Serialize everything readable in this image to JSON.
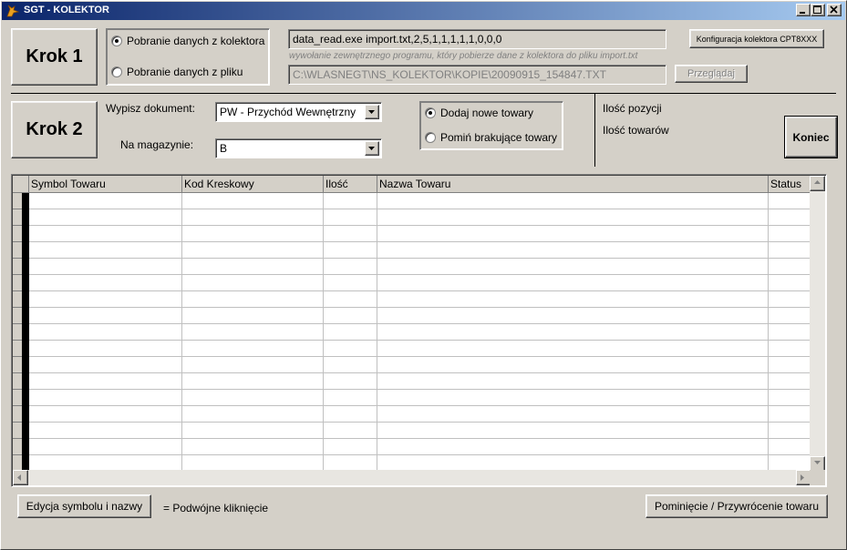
{
  "window": {
    "title": "SGT - KOLEKTOR",
    "icon": "fox-app-icon"
  },
  "step1": {
    "button_label": "Krok 1",
    "radio_collector": "Pobranie danych z kolektora",
    "radio_file": "Pobranie danych z pliku",
    "selected": "collector",
    "command_value": "data_read.exe import.txt,2,5,1,1,1,1,1,0,0,0",
    "command_hint": "wywołanie zewnętrznego programu, który pobierze dane z kolektora do pliku import.txt",
    "file_path": "C:\\WLASNEGT\\NS_KOLEKTOR\\KOPIE\\20090915_154847.TXT",
    "browse_label": "Przeglądaj",
    "config_label": "Konfiguracja kolektora CPT8XXX"
  },
  "step2": {
    "button_label": "Krok 2",
    "document_label": "Wypisz dokument:",
    "document_value": "PW - Przychód Wewnętrzny",
    "warehouse_label": "Na magazynie:",
    "warehouse_value": "B",
    "radio_add": "Dodaj nowe towary",
    "radio_skip": "Pomiń brakujące towary",
    "selected": "add"
  },
  "summary": {
    "positions_label": "Ilość pozycji",
    "items_label": "Ilość towarów",
    "end_label": "Koniec"
  },
  "grid": {
    "columns": [
      "Symbol Towaru",
      "Kod Kreskowy",
      "Ilość",
      "Nazwa Towaru",
      "Status"
    ],
    "rows": []
  },
  "footer": {
    "edit_label": "Edycja symbolu i nazwy",
    "edit_hint": "= Podwójne kliknięcie",
    "skip_restore_label": "Pominięcie / Przywrócenie towaru"
  },
  "colors": {
    "face": "#d4d0c8",
    "title_start": "#0a246a",
    "title_end": "#a6caf0"
  }
}
